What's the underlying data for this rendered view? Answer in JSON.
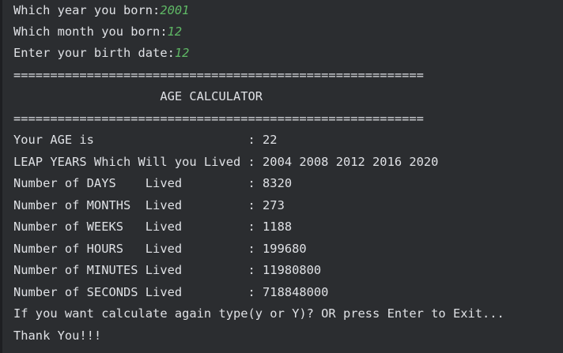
{
  "console": {
    "prompts": [
      {
        "label": "Which year you born:",
        "value": "2001"
      },
      {
        "label": "Which month you born:",
        "value": "12"
      },
      {
        "label": "Enter your birth date:",
        "value": "12"
      }
    ],
    "separator_top": "========================================================",
    "title": "                    AGE CALCULATOR",
    "separator_bottom": "========================================================",
    "results": [
      "Your AGE is                     : 22",
      "LEAP YEARS Which Will you Lived : 2004 2008 2012 2016 2020",
      "Number of DAYS    Lived         : 8320",
      "Number of MONTHS  Lived         : 273",
      "Number of WEEKS   Lived         : 1188",
      "Number of HOURS   Lived         : 199680",
      "Number of MINUTES Lived         : 11980800",
      "Number of SECONDS Lived         : 718848000"
    ],
    "retry_prompt": "If you want calculate again type(y or Y)? OR press Enter to Exit...",
    "farewell": "Thank You!!!"
  },
  "colors": {
    "background": "#2b2d30",
    "text": "#dfe1e5",
    "input": "#5fb865"
  }
}
